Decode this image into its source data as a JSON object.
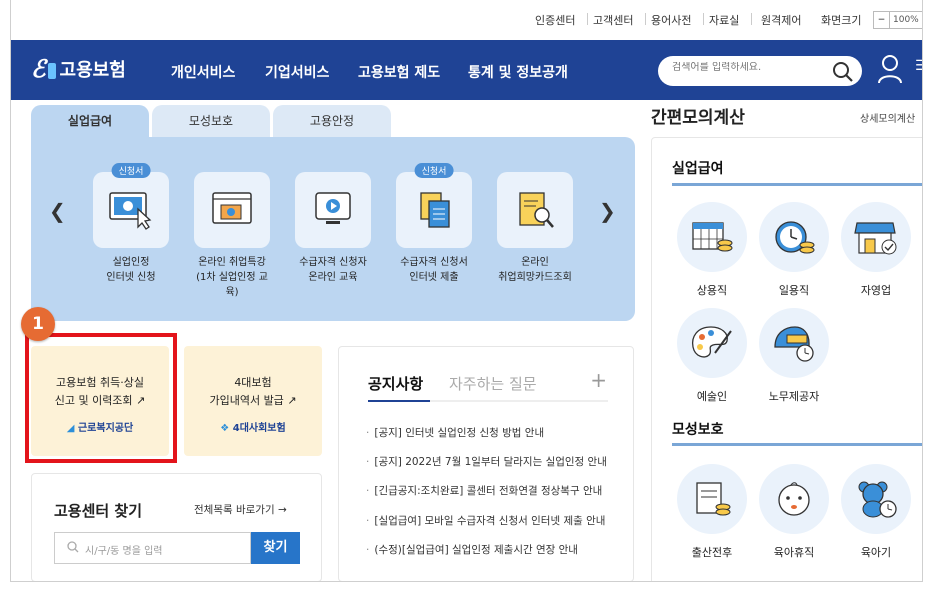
{
  "util": {
    "links": [
      "인증센터",
      "고객센터",
      "용어사전",
      "자료실",
      "원격제어",
      "화면크기"
    ],
    "zoom_minus": "−",
    "zoom_value": "100%"
  },
  "nav": {
    "logo": "고용보험",
    "menu": [
      "개인서비스",
      "기업서비스",
      "고용보험 제도",
      "통계 및 정보공개"
    ],
    "search_placeholder": "검색어를 입력하세요."
  },
  "tabs": [
    "실업급여",
    "모성보호",
    "고용안정"
  ],
  "services": [
    {
      "label1": "실업인정",
      "label2": "인터넷 신청",
      "badge": "신청서"
    },
    {
      "label1": "온라인 취업특강",
      "label2": "(1차 실업인정 교육)",
      "badge": ""
    },
    {
      "label1": "수급자격 신청자",
      "label2": "온라인 교육",
      "badge": ""
    },
    {
      "label1": "수급자격 신청서",
      "label2": "인터넷 제출",
      "badge": "신청서"
    },
    {
      "label1": "온라인",
      "label2": "취업희망카드조회",
      "badge": ""
    }
  ],
  "card1": {
    "line1": "고용보험 취득·상실",
    "line2": "신고 및 이력조회",
    "org": "근로복지공단"
  },
  "card2": {
    "line1": "4대보험",
    "line2": "가입내역서 발급",
    "org": "4대사회보험"
  },
  "step_number": "1",
  "notice": {
    "tab1": "공지사항",
    "tab2": "자주하는 질문",
    "plus": "+",
    "items": [
      "[공지] 인터넷 실업인정 신청 방법 안내",
      "[공지] 2022년 7월 1일부터 달라지는 실업인정 안내",
      "[긴급공지:조치완료] 콜센터 전화연결 정상복구 안내",
      "[실업급여] 모바일 수급자격 신청서 인터넷 제출 안내",
      "(수정)[실업급여] 실업인정 제출시간 연장 안내"
    ]
  },
  "center": {
    "title": "고용센터 찾기",
    "link": "전체목록 바로가기 →",
    "placeholder": "시/구/동 명을 입력",
    "button": "찾기"
  },
  "right": {
    "title": "간편모의계산",
    "link": "상세모의계산",
    "sec1": "실업급여",
    "items1": [
      "상용직",
      "일용직",
      "자영업",
      "예술인",
      "노무제공자"
    ],
    "sec2": "모성보호",
    "items2": [
      "출산전후",
      "육아휴직",
      "육아기"
    ]
  }
}
